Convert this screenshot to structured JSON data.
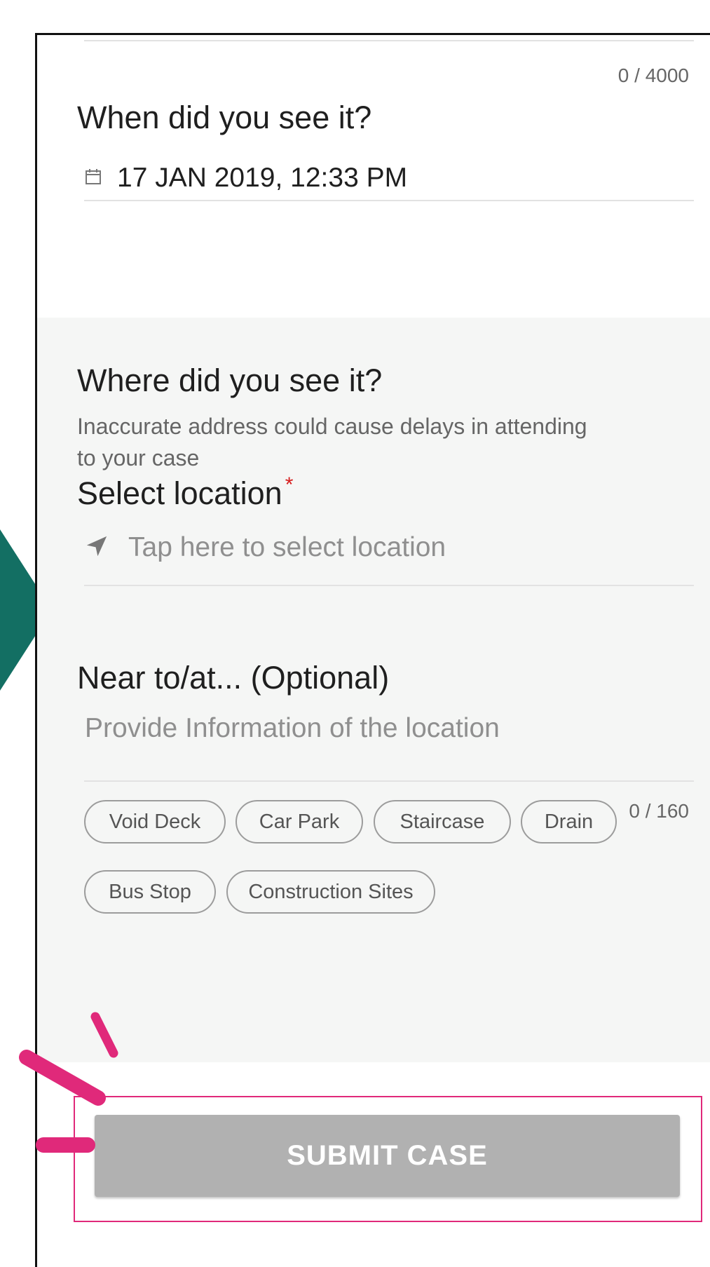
{
  "description_field": {
    "counter": "0 / 4000"
  },
  "when_section": {
    "title": "When did you see it?",
    "date_icon": "calendar-icon",
    "date_value": "17 JAN 2019, 12:33 PM"
  },
  "where_section": {
    "title": "Where did you see it?",
    "subtitle": "Inaccurate address could cause delays in attending to your case",
    "location_label": "Select location",
    "required_mark": "*",
    "location_icon": "navigation-arrow-icon",
    "location_placeholder": "Tap here to select location",
    "near_label": "Near to/at... (Optional)",
    "near_placeholder": "Provide Information of the location",
    "near_counter": "0 / 160",
    "chips": [
      "Void Deck",
      "Car Park",
      "Staircase",
      "Drain",
      "Bus Stop",
      "Construction Sites"
    ]
  },
  "submit": {
    "label": "SUBMIT CASE"
  },
  "colors": {
    "accent_pink": "#e0297a",
    "teal": "#136f63",
    "button_disabled": "#b1b1b1",
    "required_red": "#d62020",
    "section_bg": "#f5f6f5"
  }
}
